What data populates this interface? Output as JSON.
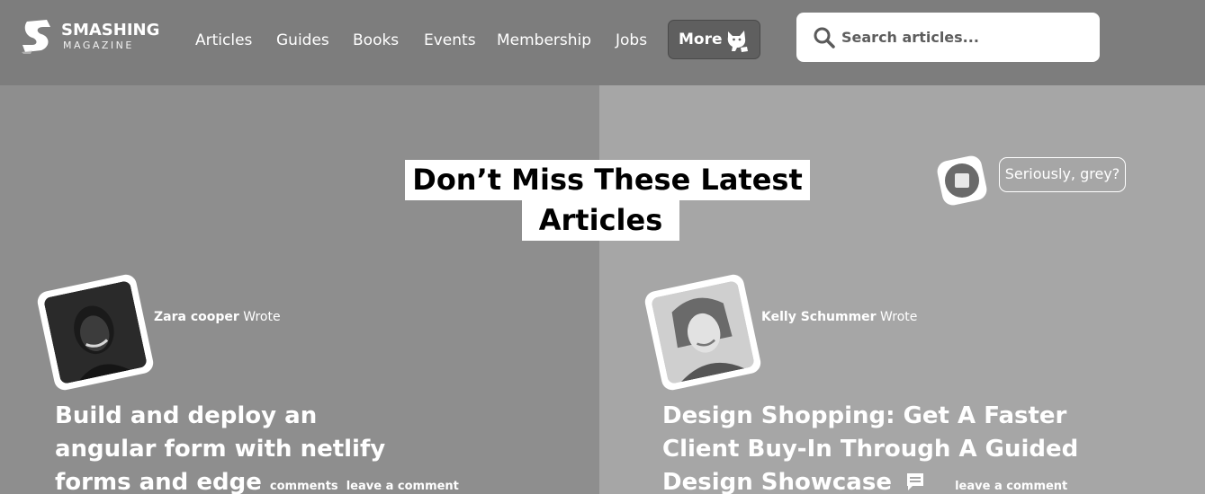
{
  "header": {
    "logo": {
      "name": "SMASHING",
      "sub": "MAGAZINE"
    },
    "nav": [
      {
        "label": "Articles"
      },
      {
        "label": "Guides"
      },
      {
        "label": "Books"
      },
      {
        "label": "Events"
      },
      {
        "label": "Membership"
      },
      {
        "label": "Jobs"
      }
    ],
    "more_label": "More",
    "search_placeholder": "Search articles..."
  },
  "main": {
    "headline_line1": "Don’t Miss These Latest",
    "headline_line2": "Articles",
    "grey_toggle_label": "Seriously, grey?",
    "articles": [
      {
        "author": "Zara cooper",
        "wrote": "Wrote",
        "title_lines": [
          "Build and deploy an",
          "angular form with netlify",
          "forms and edge"
        ],
        "comments_label": "comments",
        "leave_comment": "leave a comment"
      },
      {
        "author": "Kelly Schummer",
        "wrote": "Wrote",
        "title_lines": [
          "Design Shopping: Get A Faster",
          "Client Buy-In Through A Guided",
          "Design Showcase"
        ],
        "leave_comment": "leave a comment"
      }
    ]
  },
  "colors": {
    "header_bg": "#7d7d7d",
    "left_panel_bg": "#8e8e8e",
    "right_panel_bg": "#a6a6a6",
    "more_button_bg": "#5f5f5f"
  },
  "icons": {
    "logo": "smashing-s-logo-icon",
    "more": "cat-mascot-icon",
    "search": "search-icon",
    "grey_toggle": "grey-mode-icon",
    "comment": "comment-bubble-icon"
  }
}
